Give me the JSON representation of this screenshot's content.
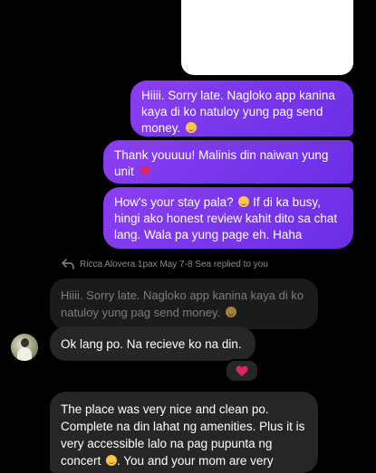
{
  "messages": {
    "sent_1": {
      "text": "Hiiii. Sorry late. Nagloko app kanina kaya di ko natuloy yung pag send money.",
      "emoji": "smiling-face-emoji"
    },
    "sent_2": {
      "text": "Thank youuuu! Malinis din naiwan yung unit",
      "emoji": "red-heart-emoji"
    },
    "sent_3": {
      "text": "How's your stay pala? ",
      "text_after": " If di ka busy, hingi ako honest review kahit dito sa chat lang. Wala pa yung page eh. Haha",
      "emoji": "grinning-face-emoji"
    },
    "reply_context": "Ricca Alovera 1pax May 7-8 Sea replied to you",
    "quoted": {
      "text": "Hiiii. Sorry late. Nagloko app kanina kaya di ko natuloy yung pag send money.",
      "emoji": "smiling-face-emoji"
    },
    "received_1": {
      "text": "Ok lang po. Na recieve ko na din."
    },
    "reaction": {
      "emoji": "red-heart-emoji"
    },
    "received_2": {
      "text_before": "The place was very nice and clean po. Complete na din lahat ng amenities. Plus it is very accessible lalo na pag pupunta ng concert ",
      "text_after": ". You and your mom are very",
      "emoji": "smiling-face-emoji"
    }
  },
  "colors": {
    "background": "#000000",
    "sent_bubble": "#7b35ec",
    "received_bubble": "#262626",
    "heart": "#e0245e"
  }
}
